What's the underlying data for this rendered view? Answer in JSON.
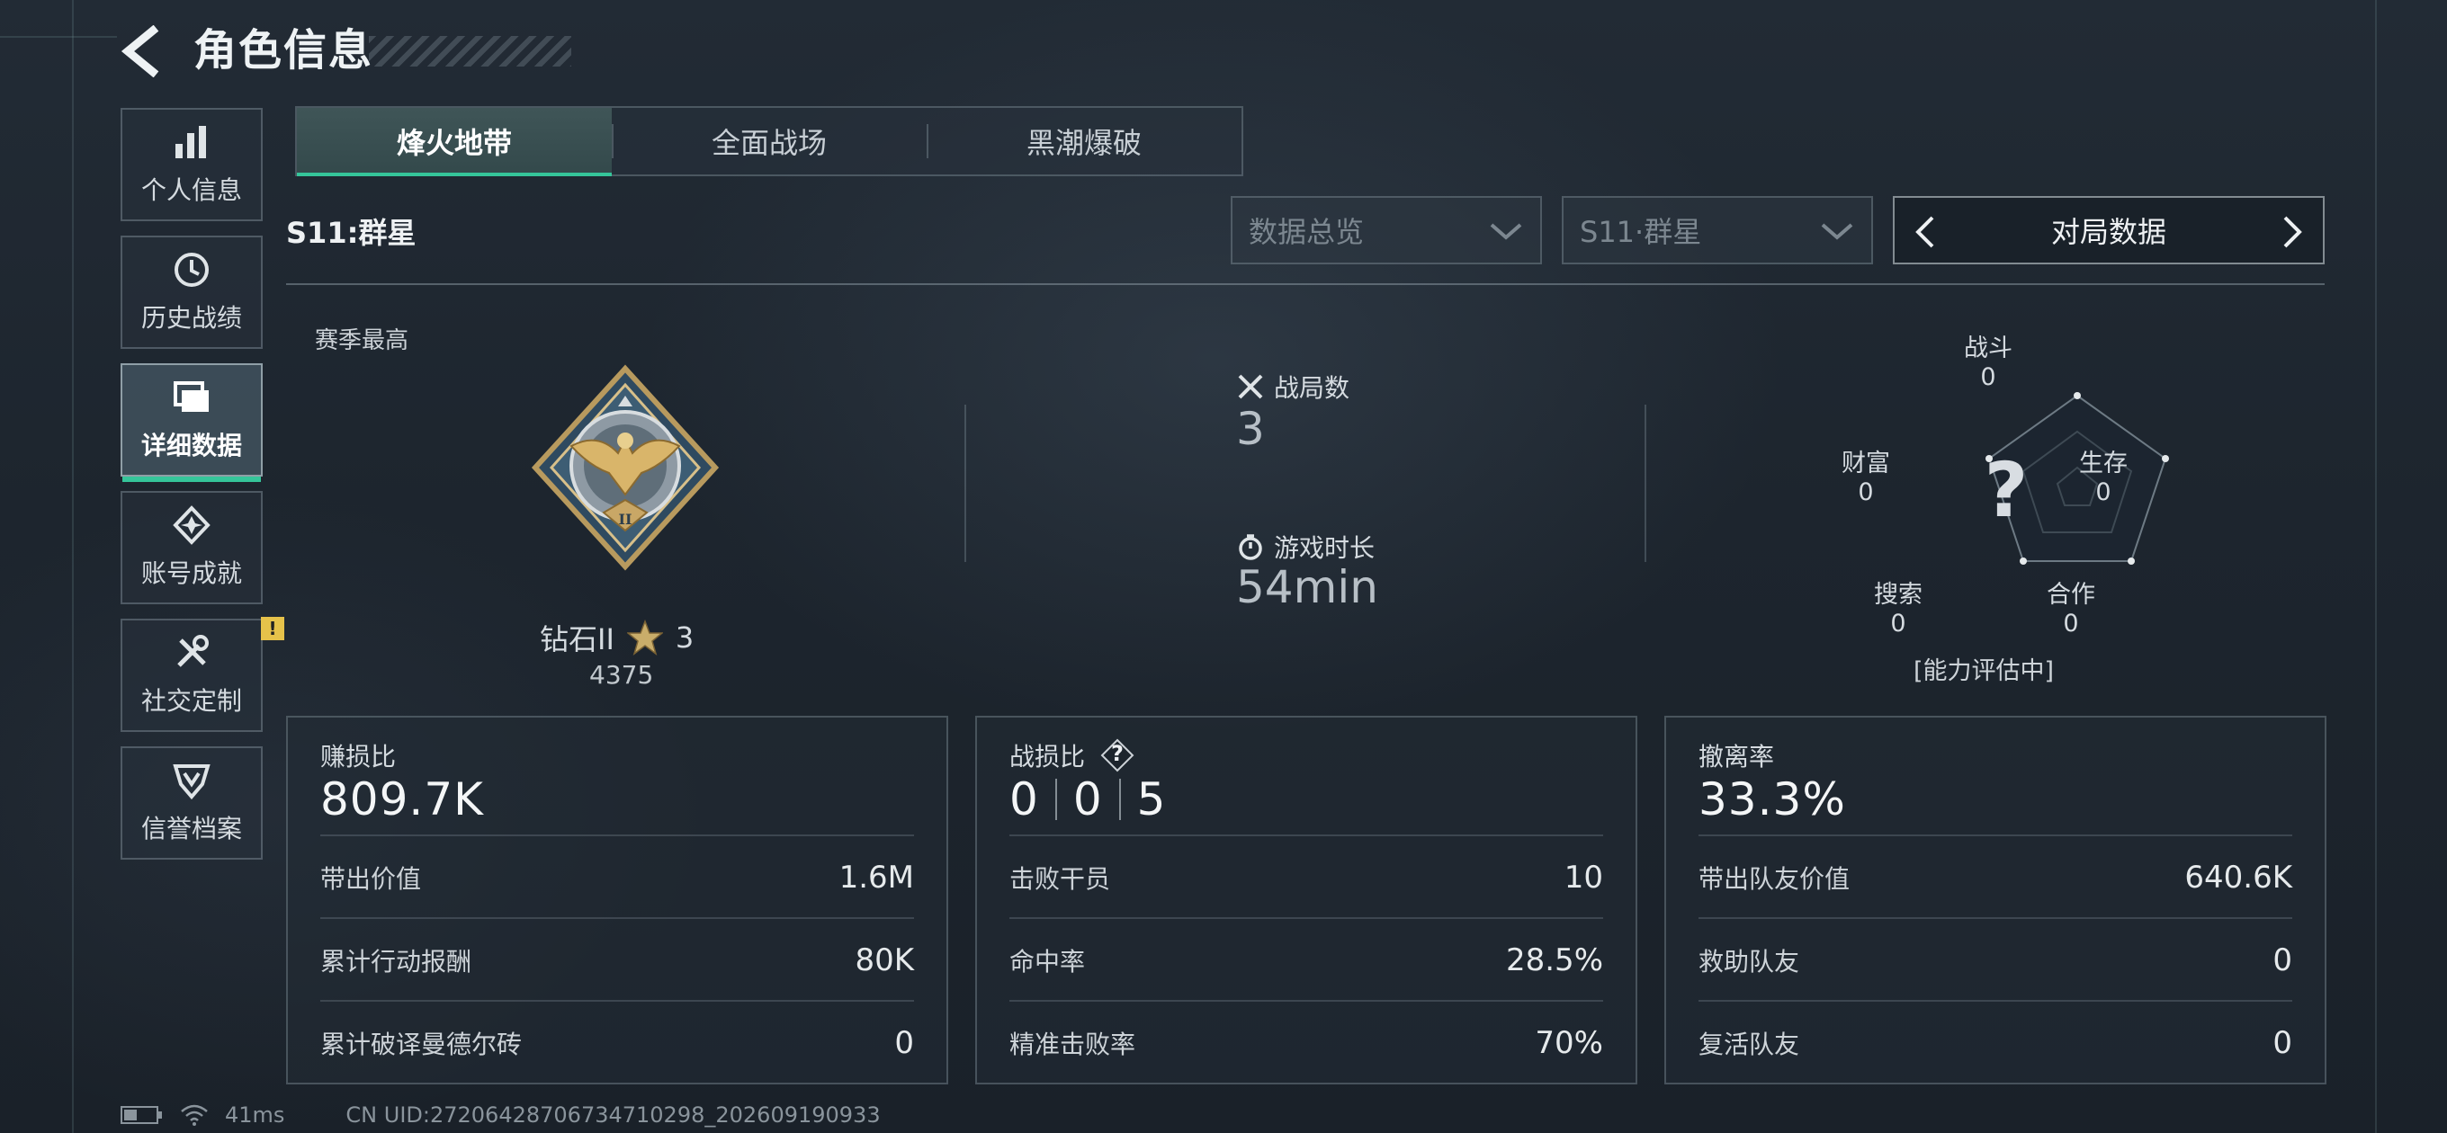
{
  "header": {
    "title": "角色信息"
  },
  "sidebar": {
    "items": [
      {
        "label": "个人信息",
        "icon": "bar-chart-icon"
      },
      {
        "label": "历史战绩",
        "icon": "history-clock-icon"
      },
      {
        "label": "详细数据",
        "icon": "folders-icon",
        "active": true
      },
      {
        "label": "账号成就",
        "icon": "achievement-badge-icon"
      },
      {
        "label": "社交定制",
        "icon": "tools-icon",
        "notice": "!"
      },
      {
        "label": "信誉档案",
        "icon": "shield-chevron-icon"
      }
    ]
  },
  "tabs": [
    {
      "label": "烽火地带",
      "active": true
    },
    {
      "label": "全面战场"
    },
    {
      "label": "黑潮爆破"
    }
  ],
  "season": {
    "label": "S11:群星"
  },
  "filters": {
    "overview": "数据总览",
    "season": "S11·群星",
    "selector": "对局数据"
  },
  "rank": {
    "season_best_label": "赛季最高",
    "tier": "钻石II",
    "stars": "3",
    "score": "4375"
  },
  "summary": {
    "matches_label": "战局数",
    "matches_value": "3",
    "playtime_label": "游戏时长",
    "playtime_value": "54min"
  },
  "radar": {
    "top": {
      "label": "战斗",
      "value": "0"
    },
    "right": {
      "label": "生存",
      "value": "0"
    },
    "bottom_right": {
      "label": "合作",
      "value": "0"
    },
    "bottom_left": {
      "label": "搜索",
      "value": "0"
    },
    "left": {
      "label": "财富",
      "value": "0"
    },
    "center": "?",
    "status": "[能力评估中]"
  },
  "cards": {
    "profit": {
      "title": "赚损比",
      "value": "809.7K",
      "rows": [
        {
          "k": "带出价值",
          "v": "1.6M"
        },
        {
          "k": "累计行动报酬",
          "v": "80K"
        },
        {
          "k": "累计破译曼德尔砖",
          "v": "0"
        }
      ]
    },
    "combat": {
      "title": "战损比",
      "help": "?",
      "kd": [
        "0",
        "0",
        "5"
      ],
      "rows": [
        {
          "k": "击败干员",
          "v": "10"
        },
        {
          "k": "命中率",
          "v": "28.5%"
        },
        {
          "k": "精准击败率",
          "v": "70%"
        }
      ]
    },
    "extract": {
      "title": "撤离率",
      "value": "33.3%",
      "rows": [
        {
          "k": "带出队友价值",
          "v": "640.6K"
        },
        {
          "k": "救助队友",
          "v": "0"
        },
        {
          "k": "复活队友",
          "v": "0"
        }
      ]
    }
  },
  "footer": {
    "ping": "41ms",
    "uid": "CN UID:27206428706734710298_202609190933"
  },
  "colors": {
    "accent": "#35c59a",
    "notice": "#e6c24a"
  }
}
